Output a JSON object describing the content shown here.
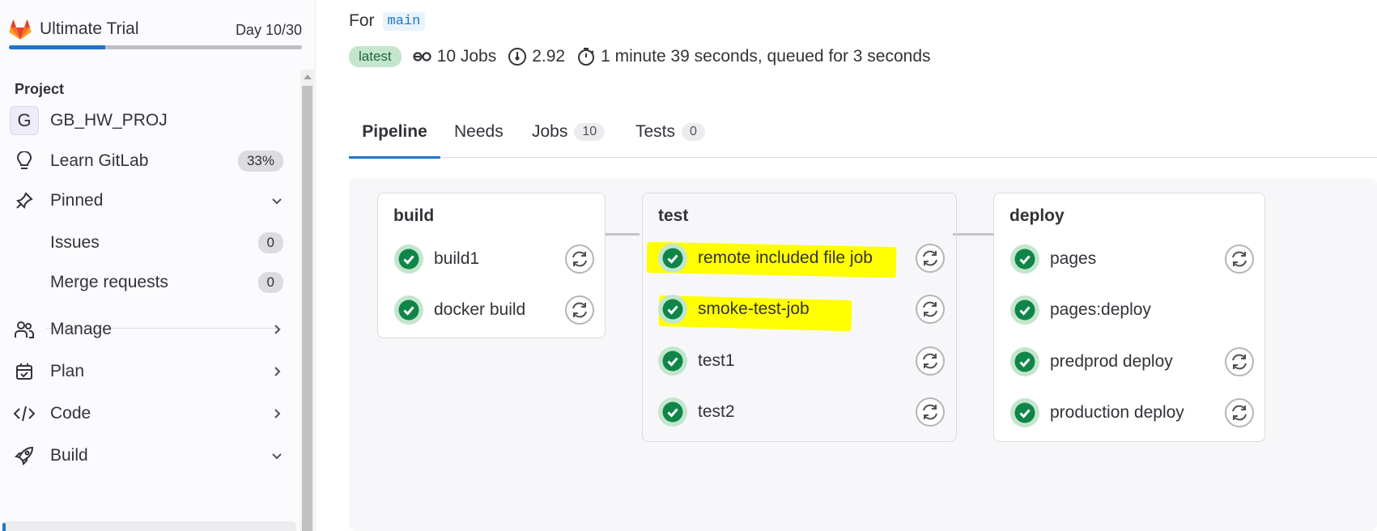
{
  "colors": {
    "accent": "#1f75cb",
    "success": "#108548",
    "highlight": "#ffff00"
  },
  "sidebar": {
    "trial": {
      "name": "Ultimate Trial",
      "day": "Day 10/30",
      "progress": 0.33
    },
    "section_title": "Project",
    "project": {
      "avatar": "G",
      "name": "GB_HW_PROJ"
    },
    "learn": {
      "label": "Learn GitLab",
      "badge": "33%",
      "icon": "lightbulb-icon"
    },
    "pinned": {
      "label": "Pinned",
      "icon": "thumbtack-icon"
    },
    "pinned_items": [
      {
        "label": "Issues",
        "count": "0"
      },
      {
        "label": "Merge requests",
        "count": "0"
      }
    ],
    "groups": [
      {
        "label": "Manage",
        "icon": "users-icon"
      },
      {
        "label": "Plan",
        "icon": "calendar-icon"
      },
      {
        "label": "Code",
        "icon": "code-icon"
      },
      {
        "label": "Build",
        "icon": "rocket-icon"
      }
    ]
  },
  "header": {
    "for_label": "For",
    "branch": "main",
    "latest_badge": "latest",
    "jobs": "10 Jobs",
    "compute": "2.92",
    "duration": "1 minute 39 seconds, queued for 3 seconds"
  },
  "tabs": [
    {
      "label": "Pipeline"
    },
    {
      "label": "Needs"
    },
    {
      "label": "Jobs",
      "count": "10"
    },
    {
      "label": "Tests",
      "count": "0"
    }
  ],
  "stages": [
    {
      "name": "build",
      "jobs": [
        "build1",
        "docker build"
      ]
    },
    {
      "name": "test",
      "jobs": [
        "remote included file job",
        "smoke-test-job",
        "test1",
        "test2"
      ]
    },
    {
      "name": "deploy",
      "jobs": [
        "pages",
        "pages:deploy",
        "predprod deploy",
        "production deploy"
      ]
    }
  ]
}
